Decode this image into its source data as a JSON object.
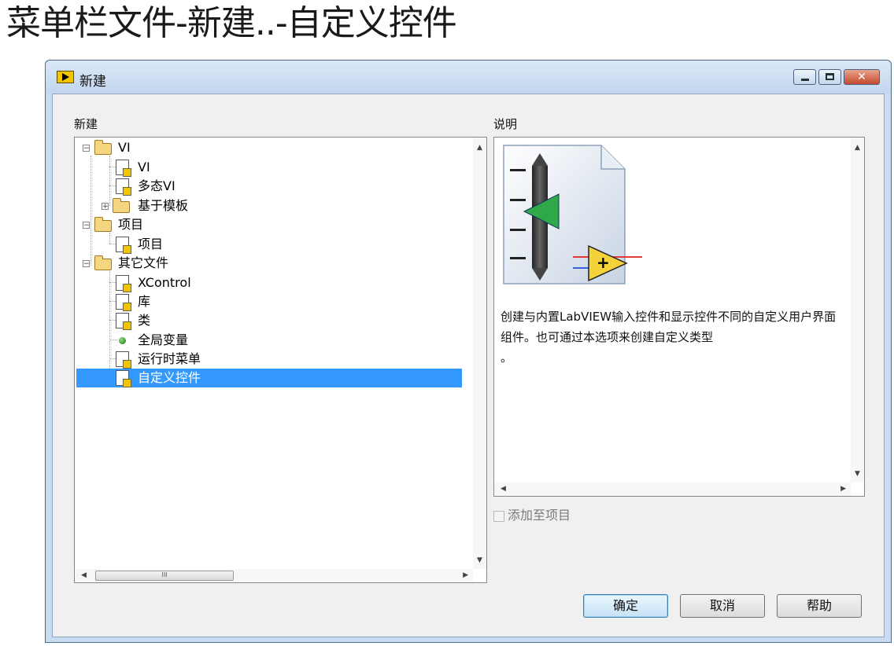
{
  "slide_title": "菜单栏文件-新建..-自定义控件",
  "window": {
    "title": "新建",
    "icon": "labview-icon",
    "controls": {
      "minimize": "minimize-icon",
      "maximize": "maximize-icon",
      "close": "close-icon"
    }
  },
  "new_panel": {
    "label": "新建",
    "tree": [
      {
        "label": "VI",
        "type": "folder",
        "expanded": true
      },
      {
        "label": "VI",
        "type": "vi-icon"
      },
      {
        "label": "多态VI",
        "type": "vi-icon"
      },
      {
        "label": "基于模板",
        "type": "folder",
        "expanded": false
      },
      {
        "label": "项目",
        "type": "folder",
        "expanded": true
      },
      {
        "label": "项目",
        "type": "project-icon"
      },
      {
        "label": "其它文件",
        "type": "folder",
        "expanded": true
      },
      {
        "label": "XControl",
        "type": "xcontrol-icon"
      },
      {
        "label": "库",
        "type": "library-icon"
      },
      {
        "label": "类",
        "type": "class-icon"
      },
      {
        "label": "全局变量",
        "type": "globe-icon"
      },
      {
        "label": "运行时菜单",
        "type": "menu-icon"
      },
      {
        "label": "自定义控件",
        "type": "control-icon",
        "selected": true
      }
    ],
    "hscroll_thumb_glyph": "III"
  },
  "description": {
    "label": "说明",
    "text": "创建与内置LabVIEW输入控件和显示控件不同的自定义用户界面组件。也可通过本选项来创建自定义类型",
    "trailing": "。"
  },
  "add_to_project": {
    "label": "添加至项目",
    "checked": false,
    "disabled": true
  },
  "buttons": {
    "ok": "确定",
    "cancel": "取消",
    "help": "帮助"
  }
}
